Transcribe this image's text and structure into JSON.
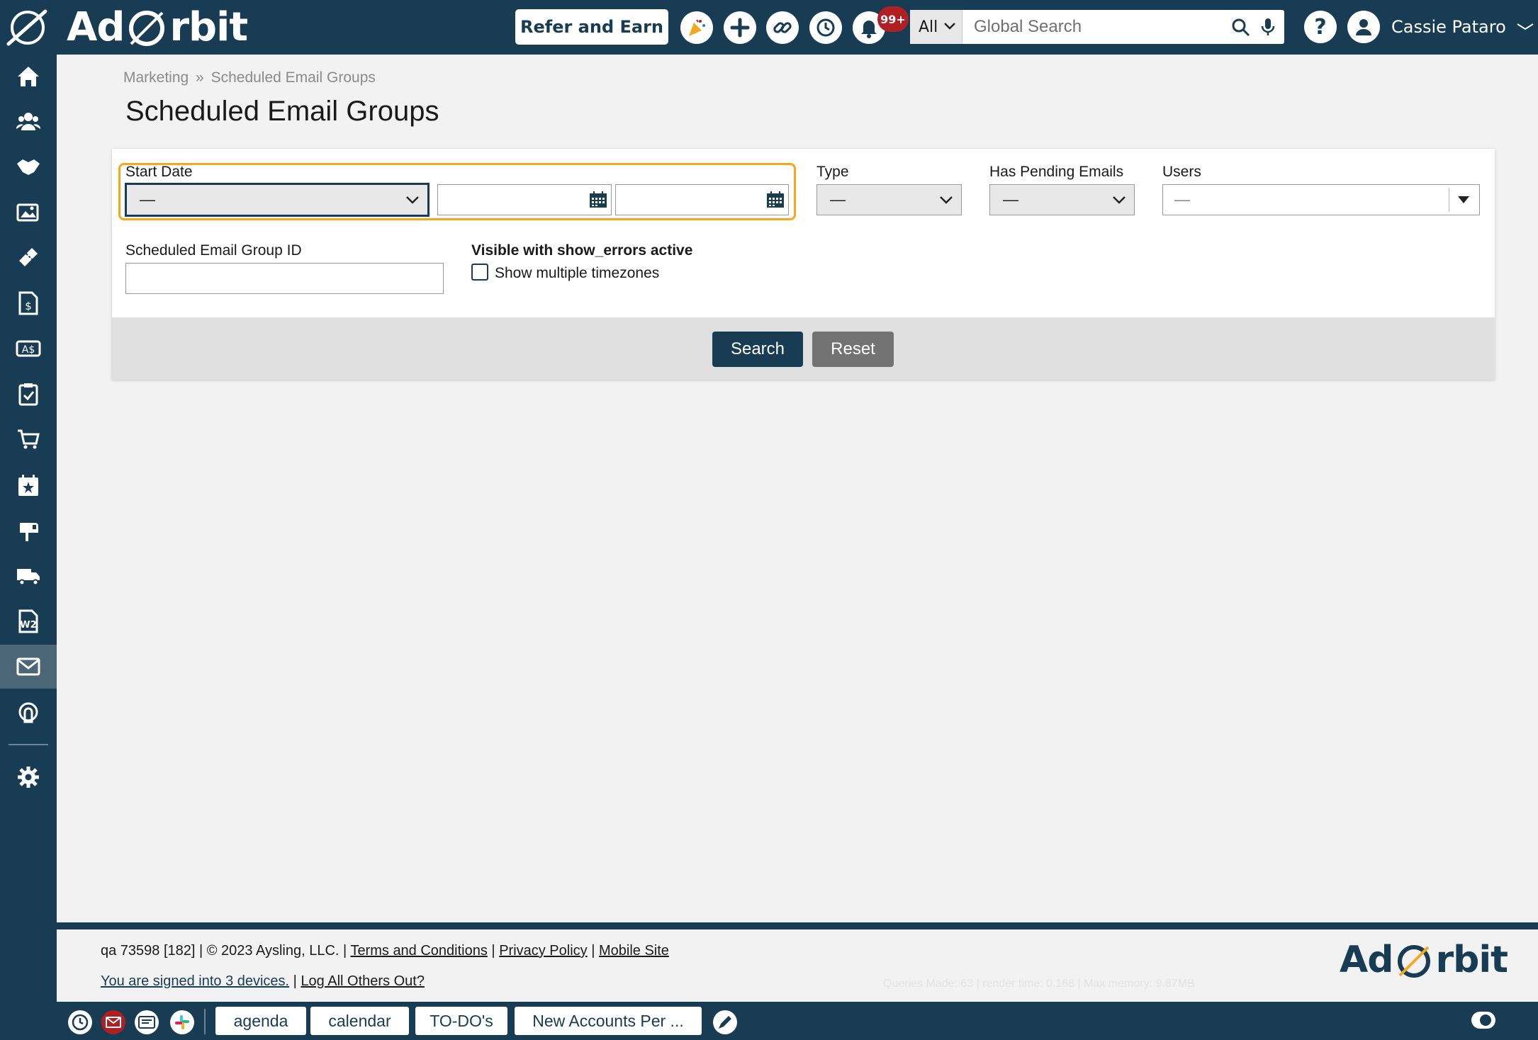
{
  "app": {
    "brand": "Ad Orbit"
  },
  "header": {
    "refer_label": "Refer and Earn",
    "notifications_badge": "99+",
    "search_scope": "All",
    "search_placeholder": "Global Search",
    "user_name": "Cassie Pataro"
  },
  "sidebar": {
    "items": [
      "home-icon",
      "contacts-icon",
      "deals-icon",
      "media-icon",
      "tickets-icon",
      "invoice-icon",
      "payments-icon",
      "tasks-icon",
      "cart-icon",
      "events-icon",
      "mailbox-icon",
      "shipping-icon",
      "w2-icon",
      "email-icon",
      "support-icon",
      "settings-icon"
    ],
    "active": "email-icon"
  },
  "breadcrumb": {
    "parent": "Marketing",
    "sep": "»",
    "current": "Scheduled Email Groups"
  },
  "page_title": "Scheduled Email Groups",
  "filters": {
    "start_date_label": "Start Date",
    "start_date_value": "—",
    "type_label": "Type",
    "type_value": "—",
    "pending_label": "Has Pending Emails",
    "pending_value": "—",
    "users_label": "Users",
    "users_value": "—",
    "group_id_label": "Scheduled Email Group ID",
    "show_errors_label": "Visible with show_errors active",
    "timezones_label": "Show multiple timezones"
  },
  "actions": {
    "search": "Search",
    "reset": "Reset"
  },
  "footer": {
    "info": "qa 73598 [182] | © 2023 Aysling, LLC. |",
    "terms": "Terms and Conditions",
    "privacy": "Privacy Policy",
    "mobile": "Mobile Site",
    "signed_in": "You are signed into 3 devices.",
    "logout_others": "Log All Others Out?",
    "stats": "Queries Made: 63 | render time: 0.168 | Max memory: 9.87MB"
  },
  "taskbar": {
    "tabs": [
      "agenda",
      "calendar",
      "TO-DO's",
      "New Accounts Per ..."
    ]
  },
  "colors": {
    "navy": "#173c53",
    "accent": "#f4a81d",
    "badge_red": "#b01f24"
  }
}
